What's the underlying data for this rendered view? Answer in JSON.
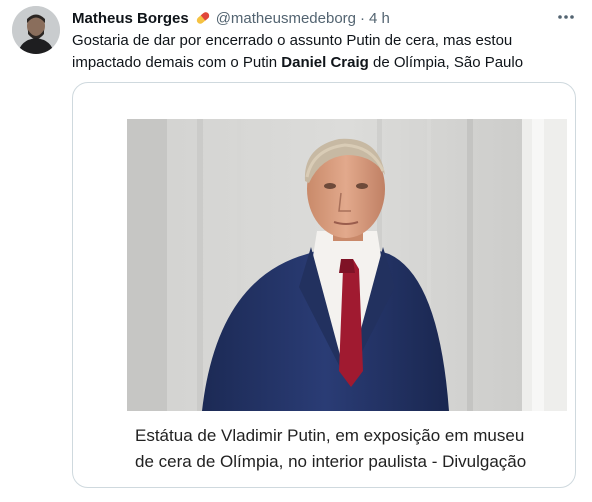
{
  "tweet": {
    "display_name": "Matheus Borges",
    "badge_icon": "pill-emoji",
    "handle": "@matheusmedeborg",
    "separator": "·",
    "time": "4 h",
    "more_icon": "more-horizontal-icon",
    "text_part1": "Gostaria de dar por encerrado o assunto Putin de cera, mas estou impactado demais com o Putin ",
    "text_bold": "Daniel Craig",
    "text_part2": " de Olímpia, São Paulo"
  },
  "media": {
    "caption_line1": "Estátua de Vladimir Putin, em exposição em museu",
    "caption_line2": "de cera de Olímpia, no interior paulista - Divulgação"
  },
  "colors": {
    "text": "#0f1419",
    "secondary": "#536471",
    "border": "#cfd9de"
  }
}
